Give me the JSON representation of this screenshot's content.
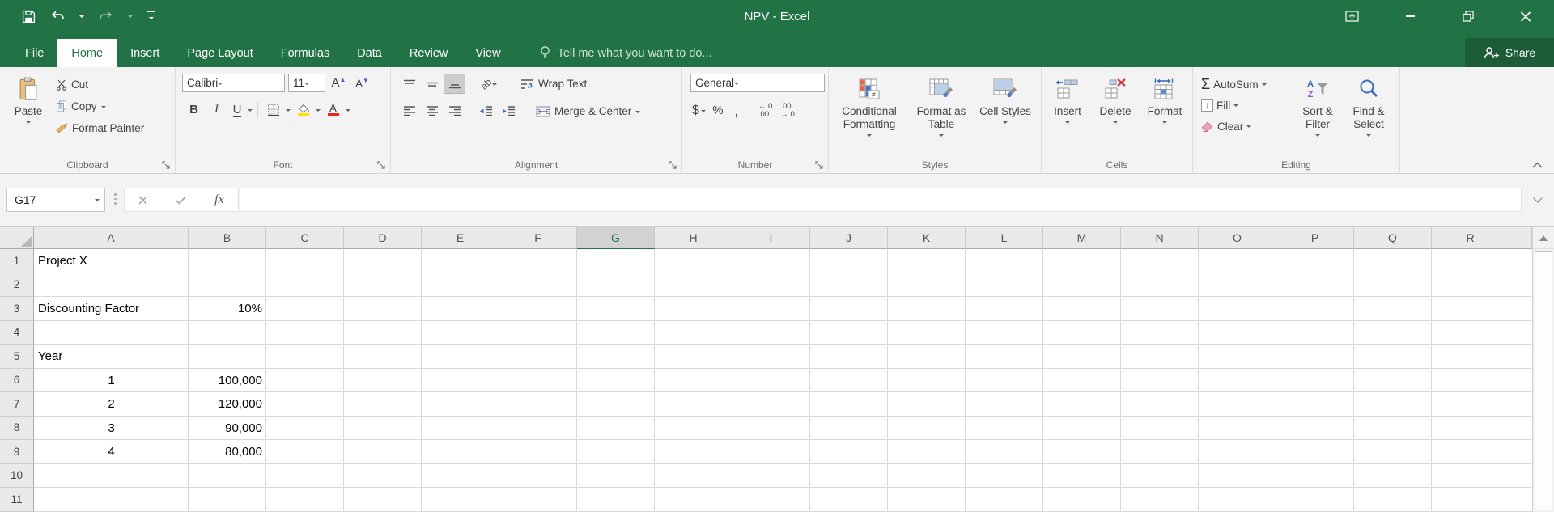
{
  "window": {
    "title": "NPV - Excel",
    "share": "Share"
  },
  "tabs": [
    {
      "label": "File"
    },
    {
      "label": "Home",
      "active": true
    },
    {
      "label": "Insert"
    },
    {
      "label": "Page Layout"
    },
    {
      "label": "Formulas"
    },
    {
      "label": "Data"
    },
    {
      "label": "Review"
    },
    {
      "label": "View"
    }
  ],
  "tell_me": "Tell me what you want to do...",
  "ribbon": {
    "clipboard": {
      "label": "Clipboard",
      "paste": "Paste",
      "cut": "Cut",
      "copy": "Copy",
      "format_painter": "Format Painter"
    },
    "font": {
      "label": "Font",
      "family": "Calibri",
      "size": "11",
      "bold": "B",
      "italic": "I",
      "underline": "U"
    },
    "alignment": {
      "label": "Alignment",
      "wrap": "Wrap Text",
      "merge": "Merge & Center"
    },
    "number": {
      "label": "Number",
      "format": "General",
      "currency": "$",
      "percent": "%",
      "comma": ",",
      "inc_top": "←.0",
      "inc_bot": ".00",
      "dec_top": ".00",
      "dec_bot": "→.0"
    },
    "styles": {
      "label": "Styles",
      "conditional": "Conditional Formatting",
      "format_table": "Format as Table",
      "cell_styles": "Cell Styles"
    },
    "cells": {
      "label": "Cells",
      "insert": "Insert",
      "delete": "Delete",
      "format": "Format"
    },
    "editing": {
      "label": "Editing",
      "autosum": "AutoSum",
      "fill": "Fill",
      "clear": "Clear",
      "sort": "Sort & Filter",
      "find": "Find & Select"
    }
  },
  "formula_bar": {
    "name_box": "G17",
    "formula": "",
    "fx": "fx"
  },
  "grid": {
    "selected_column": "G",
    "columns": [
      "A",
      "B",
      "C",
      "D",
      "E",
      "F",
      "G",
      "H",
      "I",
      "J",
      "K",
      "L",
      "M",
      "N",
      "O",
      "P",
      "Q",
      "R"
    ],
    "rows": [
      "1",
      "2",
      "3",
      "4",
      "5",
      "6",
      "7",
      "8",
      "9",
      "10",
      "11"
    ],
    "cells": [
      {
        "ref": "A1",
        "text": "Project X",
        "align": "left"
      },
      {
        "ref": "A3",
        "text": "Discounting Factor",
        "align": "left"
      },
      {
        "ref": "B3",
        "text": "10%",
        "align": "right"
      },
      {
        "ref": "A5",
        "text": "Year",
        "align": "left"
      },
      {
        "ref": "A6",
        "text": "1",
        "align": "center"
      },
      {
        "ref": "B6",
        "text": "100,000",
        "align": "right"
      },
      {
        "ref": "A7",
        "text": "2",
        "align": "center"
      },
      {
        "ref": "B7",
        "text": "120,000",
        "align": "right"
      },
      {
        "ref": "A8",
        "text": "3",
        "align": "center"
      },
      {
        "ref": "B8",
        "text": "90,000",
        "align": "right"
      },
      {
        "ref": "A9",
        "text": "4",
        "align": "center"
      },
      {
        "ref": "B9",
        "text": "80,000",
        "align": "right"
      }
    ]
  },
  "colors": {
    "accent": "#217346",
    "share_bg": "#1d5c38",
    "fill_yellow": "#ffe400",
    "font_red": "#e8281e"
  }
}
